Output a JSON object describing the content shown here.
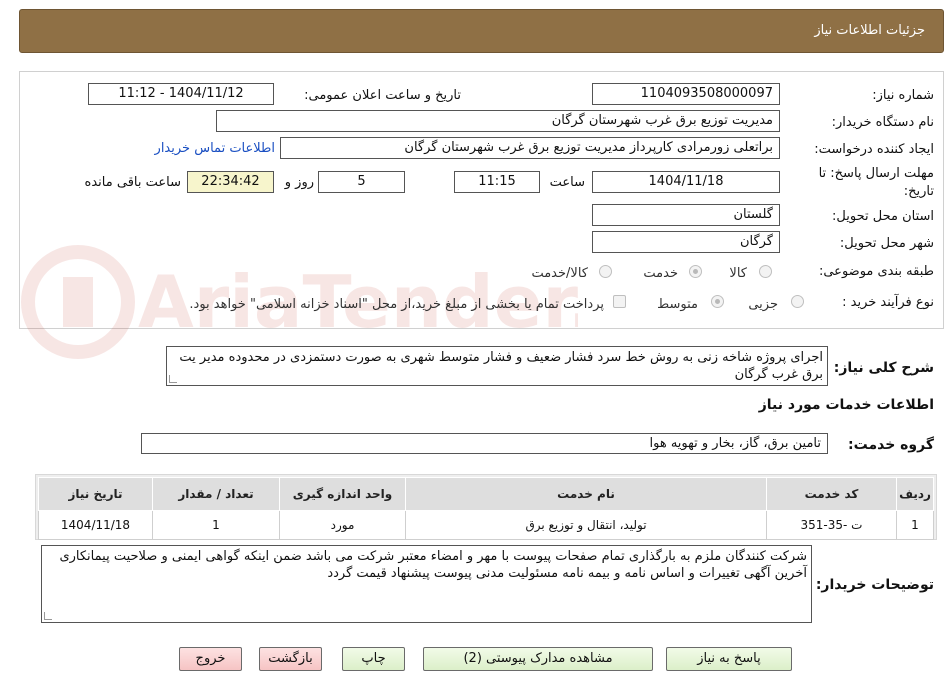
{
  "header": {
    "title": "جزئیات اطلاعات نیاز"
  },
  "form": {
    "need_number": {
      "label": "شماره نیاز:",
      "value": "1104093508000097"
    },
    "announce": {
      "label": "تاریخ و ساعت اعلان عمومی:",
      "value": "1404/11/12 - 11:12"
    },
    "buyer_org": {
      "label": "نام دستگاه خریدار:",
      "value": "مدیریت توزیع برق غرب شهرستان گرگان"
    },
    "creator": {
      "label": "ایجاد کننده درخواست:",
      "value": "براتعلی زورمرادی کارپرداز مدیریت توزیع برق غرب شهرستان گرگان",
      "contact_link": "اطلاعات تماس خریدار"
    },
    "deadline": {
      "label_line1": "مهلت ارسال پاسخ: تا",
      "label_line2": "تاریخ:",
      "date": "1404/11/18",
      "time_label": "ساعت",
      "time": "11:15",
      "days": "5",
      "days_label": "روز و",
      "remaining": "22:34:42",
      "remaining_label": "ساعت باقی مانده"
    },
    "province": {
      "label": "استان محل تحویل:",
      "value": "گلستان"
    },
    "city": {
      "label": "شهر محل تحویل:",
      "value": "گرگان"
    },
    "category": {
      "label": "طبقه بندی موضوعی:",
      "options": [
        "کالا",
        "خدمت",
        "کالا/خدمت"
      ],
      "selected": "خدمت"
    },
    "process": {
      "label": "نوع فرآیند خرید :",
      "options": [
        "جزیی",
        "متوسط"
      ],
      "selected": "متوسط",
      "payment_note": "پرداخت تمام یا بخشی از مبلغ خرید،از محل \"اسناد خزانه اسلامی\" خواهد بود."
    }
  },
  "description": {
    "label": "شرح کلی نیاز:",
    "value": "اجرای پروژه شاخه زنی به روش خط سرد فشار ضعیف و فشار متوسط شهری به صورت دستمزدی در محدوده مدیر یت برق غرب گرگان"
  },
  "services": {
    "title": "اطلاعات خدمات مورد نیاز",
    "group_label": "گروه خدمت:",
    "group_value": "تامین برق، گاز، بخار و تهویه هوا",
    "columns": [
      "ردیف",
      "کد خدمت",
      "نام خدمت",
      "واحد اندازه گیری",
      "تعداد / مقدار",
      "تاریخ نیاز"
    ],
    "rows": [
      [
        "1",
        "ت -35-351",
        "تولید، انتقال و توزیع برق",
        "مورد",
        "1",
        "1404/11/18"
      ]
    ]
  },
  "buyer_notes": {
    "label": "توضیحات خریدار:",
    "value": "شرکت کنندگان ملزم به بارگذاری تمام صفحات پیوست با مهر و امضاء معتبر شرکت می باشد ضمن اینکه گواهی ایمنی و صلاحیت پیمانکاری آخرین آگهی تغییرات و اساس نامه و بیمه نامه مسئولیت مدنی پیوست پیشنهاد قیمت گردد"
  },
  "buttons": {
    "respond": "پاسخ به نیاز",
    "docs": "مشاهده مدارک پیوستی (2)",
    "print": "چاپ",
    "back": "بازگشت",
    "exit": "خروج"
  },
  "watermark": {
    "text": "AriaTender.neT",
    "color": "#c0392b"
  }
}
